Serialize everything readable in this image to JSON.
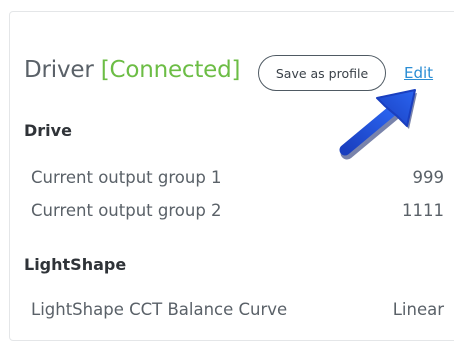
{
  "header": {
    "title": "Driver",
    "status": "[Connected]",
    "save_profile_label": "Save as profile",
    "edit_label": "Edit"
  },
  "sections": [
    {
      "title": "Drive",
      "rows": [
        {
          "label": "Current output group 1",
          "value": "999"
        },
        {
          "label": "Current output group 2",
          "value": "1111"
        }
      ]
    },
    {
      "title": "LightShape",
      "rows": [
        {
          "label": "LightShape CCT Balance Curve",
          "value": "Linear"
        }
      ]
    }
  ],
  "colors": {
    "status_green": "#6cbd45",
    "link_blue": "#2a8dd4",
    "arrow_blue": "#1e4fd8"
  },
  "icons": {
    "annotation": "arrow-icon"
  }
}
